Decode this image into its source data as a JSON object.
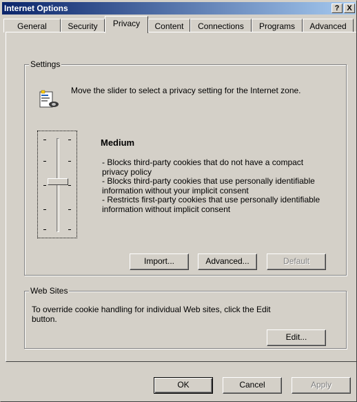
{
  "window": {
    "title": "Internet Options",
    "help_glyph": "?",
    "close_glyph": "X"
  },
  "tabs": [
    {
      "label": "General"
    },
    {
      "label": "Security"
    },
    {
      "label": "Privacy",
      "active": true
    },
    {
      "label": "Content"
    },
    {
      "label": "Connections"
    },
    {
      "label": "Programs"
    },
    {
      "label": "Advanced"
    }
  ],
  "settings": {
    "legend": "Settings",
    "intro": "Move the slider to select a privacy setting for the Internet zone.",
    "slider_level": 0.5,
    "level_name": "Medium",
    "description_lines": [
      "- Blocks third-party cookies that do not have a compact",
      "privacy policy",
      "- Blocks third-party cookies that use personally identifiable",
      "information without your implicit consent",
      "- Restricts first-party cookies that use personally identifiable",
      "information without implicit consent"
    ],
    "buttons": {
      "import": "Import...",
      "advanced": "Advanced...",
      "default": "Default"
    }
  },
  "web_sites": {
    "legend": "Web Sites",
    "text": "To override cookie handling for individual Web sites, click the Edit button.",
    "edit": "Edit..."
  },
  "dialog_buttons": {
    "ok": "OK",
    "cancel": "Cancel",
    "apply": "Apply"
  },
  "colors": {
    "title_gradient_start": "#0a246a",
    "title_gradient_end": "#a6caf0",
    "face": "#d4d0c8"
  }
}
